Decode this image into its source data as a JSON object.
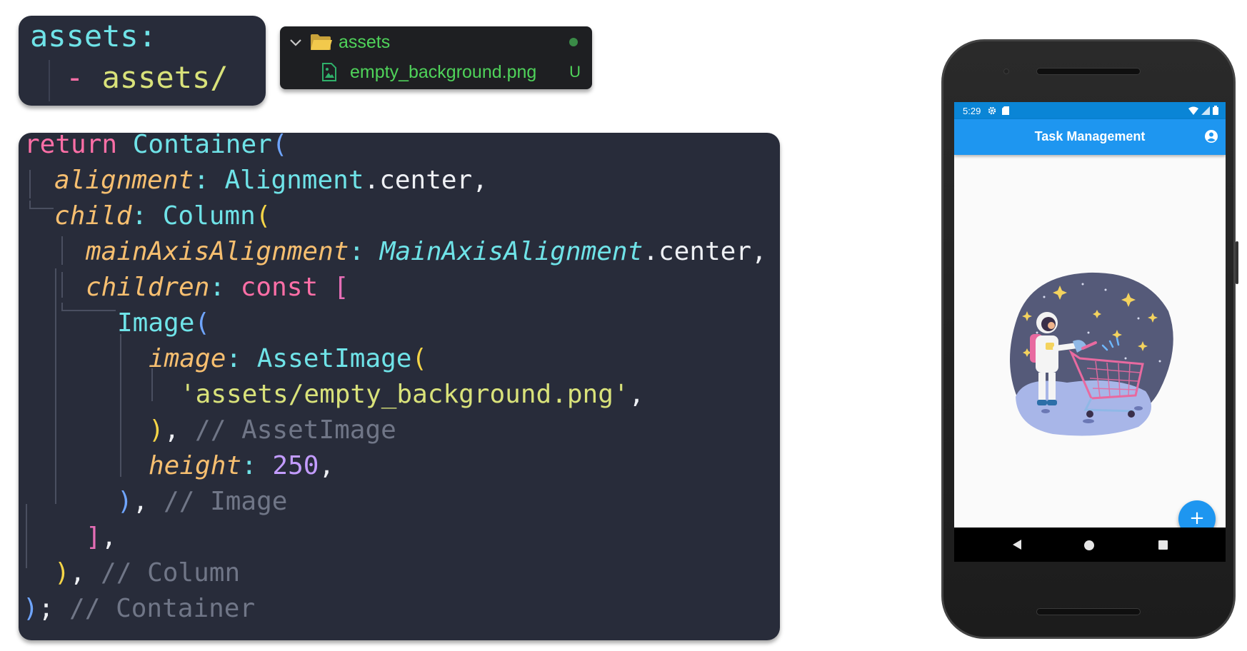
{
  "pubspec": {
    "key": "assets",
    "colon": ":",
    "dash": "- ",
    "value": "assets/"
  },
  "explorer": {
    "folder": "assets",
    "file": "empty_background.png",
    "file_status": "U"
  },
  "code": {
    "line1": {
      "kw": "return",
      "cls": "Container",
      "paren": "("
    },
    "line2": {
      "prop": "alignment",
      "colon": ": ",
      "cls": "Alignment",
      "rest": ".center,"
    },
    "line3": {
      "prop": "child",
      "colon": ": ",
      "cls": "Column",
      "paren": "("
    },
    "line4": {
      "prop": "mainAxisAlignment",
      "colon": ": ",
      "cls": "MainAxisAlignment",
      "rest": ".center,"
    },
    "line5": {
      "prop": "children",
      "colon": ": ",
      "kw": "const",
      "bracket": "["
    },
    "line6": {
      "cls": "Image",
      "paren": "("
    },
    "line7": {
      "prop": "image",
      "colon": ": ",
      "cls": "AssetImage",
      "paren": "("
    },
    "line8": {
      "str": "'assets/empty_background.png'",
      "rest": ","
    },
    "line9": {
      "paren": ")",
      "rest": ", ",
      "comment": "// AssetImage"
    },
    "line10": {
      "prop": "height",
      "colon": ": ",
      "num": "250",
      "rest": ","
    },
    "line11": {
      "paren": ")",
      "rest": ", ",
      "comment": "// Image"
    },
    "line12": {
      "bracket": "]",
      "rest": ","
    },
    "line13": {
      "paren": ")",
      "rest": ", ",
      "comment": "// Column"
    },
    "line14": {
      "paren": ")",
      "rest": "; ",
      "comment": "// Container"
    }
  },
  "phone": {
    "status_time": "5:29",
    "app_title": "Task Management",
    "fab_label": "+"
  },
  "colors": {
    "code_bg": "#282c3a",
    "app_bar": "#1e96f0",
    "status_bar": "#0a85d6",
    "folder_text": "#4fd35a"
  }
}
